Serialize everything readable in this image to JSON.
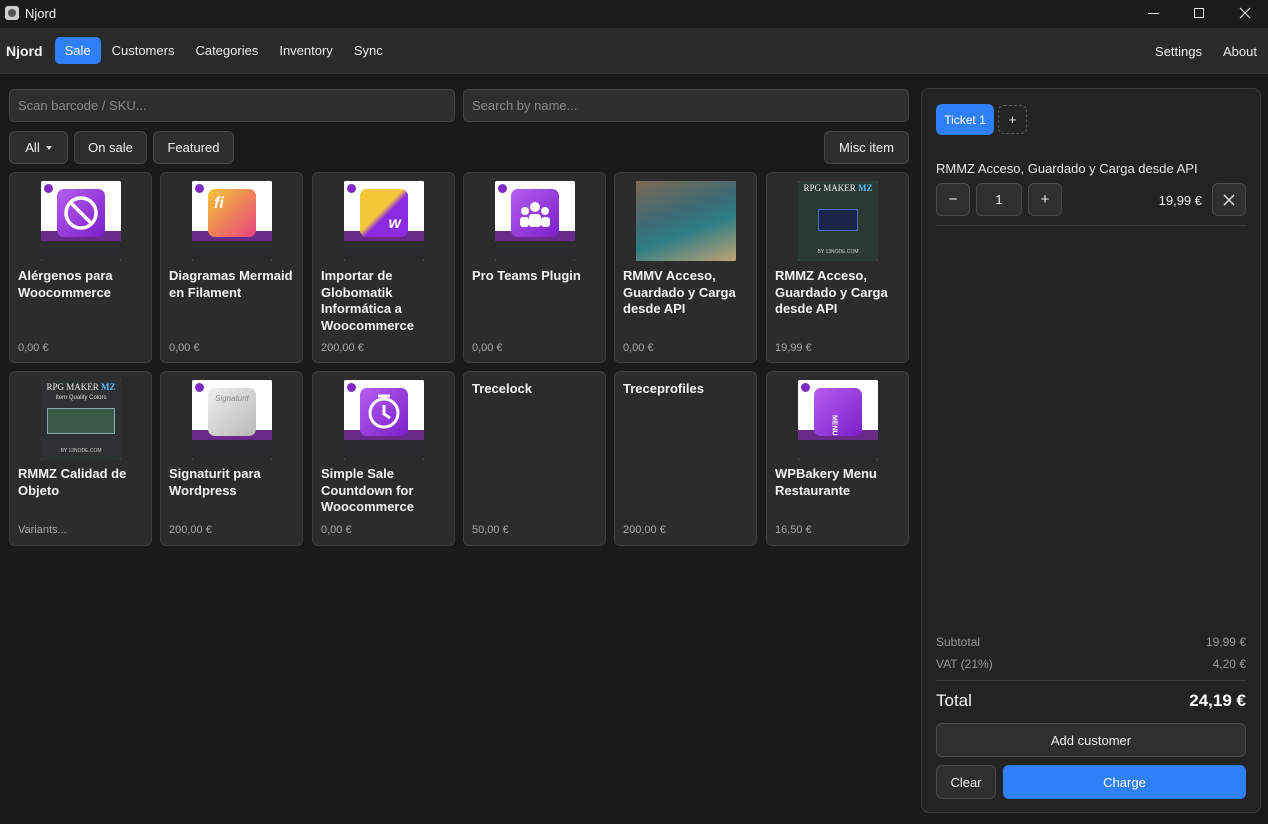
{
  "window": {
    "title": "Njord",
    "controls": [
      "minimize",
      "maximize",
      "close"
    ]
  },
  "nav": {
    "brand": "Njord",
    "items": [
      "Sale",
      "Customers",
      "Categories",
      "Inventory",
      "Sync"
    ],
    "active": "Sale",
    "right_items": [
      "Settings",
      "About"
    ]
  },
  "search": {
    "barcode_placeholder": "Scan barcode / SKU...",
    "name_placeholder": "Search by name..."
  },
  "filters": {
    "all": "All",
    "on_sale": "On sale",
    "featured": "Featured",
    "misc": "Misc item"
  },
  "products": [
    {
      "name": "Alérgenos para Woocommerce",
      "price": "0,00 €",
      "thumb": "allergen-icon"
    },
    {
      "name": "Diagramas Mermaid en Filament",
      "price": "0,00 €",
      "thumb": "mermaid-icon"
    },
    {
      "name": "Importar de Globomatik Informática a Woocommerce",
      "price": "200,00 €",
      "thumb": "import-icon"
    },
    {
      "name": "Pro Teams Plugin",
      "price": "0,00 €",
      "thumb": "teams-icon"
    },
    {
      "name": "RMMV Acceso, Guardado y Carga desde API",
      "price": "0,00 €",
      "thumb": "map-image"
    },
    {
      "name": "RMMZ Acceso, Guardado y Carga desde API",
      "price": "19,99 €",
      "thumb": "rpg-login-image"
    },
    {
      "name": "RMMZ Calidad de Objeto",
      "price": "Variants...",
      "thumb": "rpg-quality-image"
    },
    {
      "name": "Signaturit para Wordpress",
      "price": "200,00 €",
      "thumb": "signaturit-icon"
    },
    {
      "name": "Simple Sale Countdown for Woocommerce",
      "price": "0,00 €",
      "thumb": "timer-icon"
    },
    {
      "name": "Trecelock",
      "price": "50,00 €",
      "thumb": ""
    },
    {
      "name": "Treceprofiles",
      "price": "200,00 €",
      "thumb": ""
    },
    {
      "name": "WPBakery Menu Restaurante",
      "price": "16,50 €",
      "thumb": "menu-icon"
    }
  ],
  "thumb_text": {
    "mermaid": "fi",
    "import": "w",
    "menu": "MENU",
    "signaturit": "Signaturit",
    "rpg_maker": "RPG MAKER",
    "rpg_mz": "MZ",
    "rpg_quality": "Item Quality Colors",
    "rpg_footer": "BY 13NODE.COM"
  },
  "ticket": {
    "tabs": [
      "Ticket 1"
    ],
    "add_tab": "+",
    "line": {
      "name": "RMMZ Acceso, Guardado y Carga desde API",
      "minus": "−",
      "qty": "1",
      "plus": "+",
      "price": "19,99 €"
    },
    "subtotal_label": "Subtotal",
    "subtotal": "19,99 €",
    "vat_label": "VAT (21%)",
    "vat": "4,20 €",
    "total_label": "Total",
    "total": "24,19 €",
    "add_customer": "Add customer",
    "clear": "Clear",
    "charge": "Charge"
  },
  "colors": {
    "accent": "#2f7ff7",
    "background": "#1a1a1a",
    "card": "#2c2c2c",
    "panel": "#232323"
  }
}
